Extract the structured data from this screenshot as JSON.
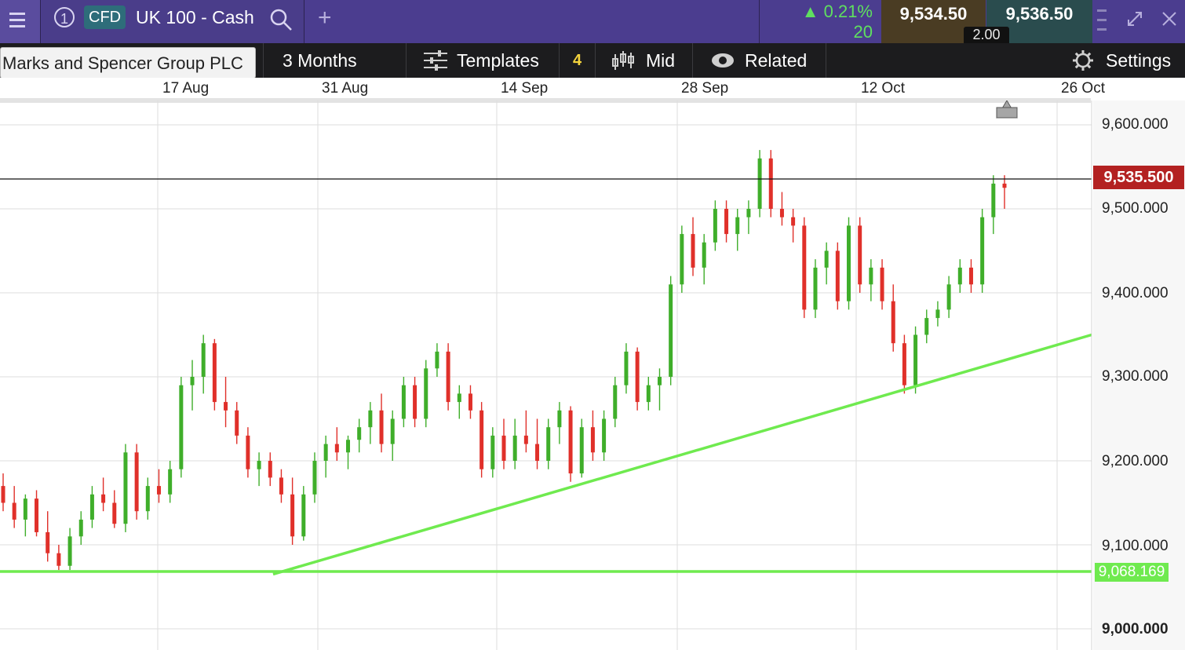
{
  "header": {
    "instrument_number": "1",
    "product_badge": "CFD",
    "instrument_name": "UK 100 - Cash",
    "add_tab": "+",
    "change_percent": "0.21%",
    "change_points": "20",
    "sell_price": "9,534.50",
    "buy_price": "9,536.50",
    "spread": "2.00",
    "colors": {
      "header_bg": "#4b3d8f",
      "positive": "#5fe05f",
      "sell_bg": "#4a3c23",
      "buy_bg": "#2a4c4e"
    }
  },
  "toolbar": {
    "tooltip": "Marks and Spencer Group PLC",
    "period": "3 Months",
    "templates": "Templates",
    "indicator_count": "4",
    "price_type": "Mid",
    "related": "Related",
    "settings": "Settings"
  },
  "chart_data": {
    "type": "candlestick",
    "x_labels": [
      "17 Aug",
      "31 Aug",
      "14 Sep",
      "28 Sep",
      "12 Oct",
      "26 Oct"
    ],
    "y_ticks": [
      "9,600.000",
      "9,500.000",
      "9,400.000",
      "9,300.000",
      "9,200.000",
      "9,100.000",
      "9,000.000"
    ],
    "ylim": [
      9000,
      9600
    ],
    "current_price_label": "9,535.500",
    "current_price": 9535.5,
    "support_level_label": "9,068.169",
    "support_level": 9068.169,
    "up_color": "#3fae2a",
    "down_color": "#e0302a",
    "trendline_color": "#6fea4f",
    "grid": true,
    "trendline": {
      "from": [
        "~24 Aug",
        9065
      ],
      "to": [
        "~1 Nov",
        9350
      ]
    },
    "series": [
      {
        "values": [
          [
            9170,
            9185,
            9140,
            9150
          ],
          [
            9150,
            9170,
            9120,
            9130
          ],
          [
            9130,
            9160,
            9110,
            9155
          ],
          [
            9155,
            9165,
            9110,
            9115
          ],
          [
            9115,
            9140,
            9080,
            9090
          ],
          [
            9090,
            9100,
            9070,
            9075
          ],
          [
            9075,
            9120,
            9070,
            9110
          ],
          [
            9110,
            9140,
            9100,
            9130
          ],
          [
            9130,
            9170,
            9120,
            9160
          ],
          [
            9160,
            9180,
            9140,
            9150
          ],
          [
            9150,
            9165,
            9120,
            9125
          ],
          [
            9125,
            9220,
            9115,
            9210
          ],
          [
            9210,
            9220,
            9130,
            9140
          ],
          [
            9140,
            9180,
            9130,
            9170
          ],
          [
            9170,
            9190,
            9150,
            9160
          ],
          [
            9160,
            9200,
            9150,
            9190
          ],
          [
            9190,
            9300,
            9180,
            9290
          ],
          [
            9290,
            9320,
            9260,
            9300
          ],
          [
            9300,
            9350,
            9280,
            9340
          ],
          [
            9340,
            9345,
            9260,
            9270
          ],
          [
            9270,
            9300,
            9240,
            9260
          ],
          [
            9260,
            9270,
            9220,
            9230
          ],
          [
            9230,
            9240,
            9180,
            9190
          ],
          [
            9190,
            9210,
            9170,
            9200
          ],
          [
            9200,
            9210,
            9170,
            9180
          ],
          [
            9180,
            9190,
            9150,
            9160
          ],
          [
            9160,
            9180,
            9100,
            9110
          ],
          [
            9110,
            9170,
            9105,
            9160
          ],
          [
            9160,
            9210,
            9150,
            9200
          ],
          [
            9200,
            9230,
            9180,
            9220
          ],
          [
            9220,
            9240,
            9200,
            9210
          ],
          [
            9210,
            9230,
            9190,
            9225
          ],
          [
            9225,
            9250,
            9210,
            9240
          ],
          [
            9240,
            9270,
            9220,
            9260
          ],
          [
            9260,
            9280,
            9210,
            9220
          ],
          [
            9220,
            9260,
            9200,
            9250
          ],
          [
            9250,
            9300,
            9240,
            9290
          ],
          [
            9290,
            9300,
            9240,
            9250
          ],
          [
            9250,
            9320,
            9240,
            9310
          ],
          [
            9310,
            9340,
            9300,
            9330
          ],
          [
            9330,
            9340,
            9260,
            9270
          ],
          [
            9270,
            9290,
            9250,
            9280
          ],
          [
            9280,
            9290,
            9250,
            9260
          ],
          [
            9260,
            9270,
            9180,
            9190
          ],
          [
            9190,
            9240,
            9180,
            9230
          ],
          [
            9230,
            9250,
            9190,
            9200
          ],
          [
            9200,
            9250,
            9190,
            9230
          ],
          [
            9230,
            9260,
            9210,
            9220
          ],
          [
            9220,
            9250,
            9190,
            9200
          ],
          [
            9200,
            9250,
            9190,
            9240
          ],
          [
            9240,
            9270,
            9220,
            9260
          ],
          [
            9260,
            9265,
            9175,
            9185
          ],
          [
            9185,
            9250,
            9180,
            9240
          ],
          [
            9240,
            9260,
            9200,
            9210
          ],
          [
            9210,
            9260,
            9200,
            9250
          ],
          [
            9250,
            9300,
            9240,
            9290
          ],
          [
            9290,
            9340,
            9280,
            9330
          ],
          [
            9330,
            9335,
            9260,
            9270
          ],
          [
            9270,
            9300,
            9260,
            9290
          ],
          [
            9290,
            9310,
            9260,
            9300
          ],
          [
            9300,
            9420,
            9290,
            9410
          ],
          [
            9410,
            9480,
            9400,
            9470
          ],
          [
            9470,
            9490,
            9420,
            9430
          ],
          [
            9430,
            9470,
            9410,
            9460
          ],
          [
            9460,
            9510,
            9450,
            9500
          ],
          [
            9500,
            9510,
            9460,
            9470
          ],
          [
            9470,
            9500,
            9450,
            9490
          ],
          [
            9490,
            9510,
            9470,
            9500
          ],
          [
            9500,
            9570,
            9490,
            9560
          ],
          [
            9560,
            9570,
            9490,
            9500
          ],
          [
            9500,
            9520,
            9480,
            9490
          ],
          [
            9490,
            9500,
            9460,
            9480
          ],
          [
            9480,
            9490,
            9370,
            9380
          ],
          [
            9380,
            9440,
            9370,
            9430
          ],
          [
            9430,
            9460,
            9410,
            9450
          ],
          [
            9450,
            9460,
            9380,
            9390
          ],
          [
            9390,
            9490,
            9380,
            9480
          ],
          [
            9480,
            9490,
            9400,
            9410
          ],
          [
            9410,
            9440,
            9390,
            9430
          ],
          [
            9430,
            9440,
            9380,
            9390
          ],
          [
            9390,
            9410,
            9330,
            9340
          ],
          [
            9340,
            9350,
            9280,
            9290
          ],
          [
            9290,
            9360,
            9280,
            9350
          ],
          [
            9350,
            9380,
            9340,
            9370
          ],
          [
            9370,
            9390,
            9360,
            9380
          ],
          [
            9380,
            9420,
            9370,
            9410
          ],
          [
            9410,
            9440,
            9400,
            9430
          ],
          [
            9430,
            9440,
            9400,
            9410
          ],
          [
            9410,
            9500,
            9400,
            9490
          ],
          [
            9490,
            9540,
            9470,
            9530
          ],
          [
            9530,
            9540,
            9500,
            9525
          ]
        ]
      }
    ]
  }
}
